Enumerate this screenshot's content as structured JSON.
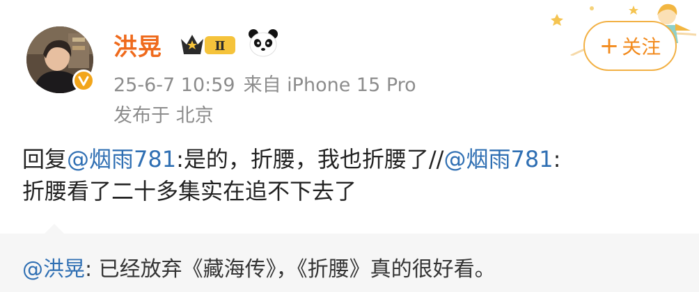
{
  "author": {
    "name": "洪晃",
    "level_badge": "Ⅱ",
    "follow_label": "关注",
    "follow_plus": "+"
  },
  "meta": {
    "timestamp": "25-6-7 10:59",
    "source": "来自 iPhone 15 Pro",
    "location": "发布于 北京"
  },
  "post": {
    "reply_prefix": "回复",
    "mention1": "@烟雨781",
    "text1": ":是的，折腰，我也折腰了//",
    "mention2": "@烟雨781",
    "text2": ":",
    "text3": "折腰看了二十多集实在追不下去了"
  },
  "repost": {
    "mention": "@洪晃",
    "text": ": 已经放弃《藏海传》，《折腰》真的很好看。"
  },
  "colors": {
    "username": "#ef6a1c",
    "link": "#2f6fb3",
    "follow_border": "#f2b043",
    "meta": "#8c8c8c"
  }
}
